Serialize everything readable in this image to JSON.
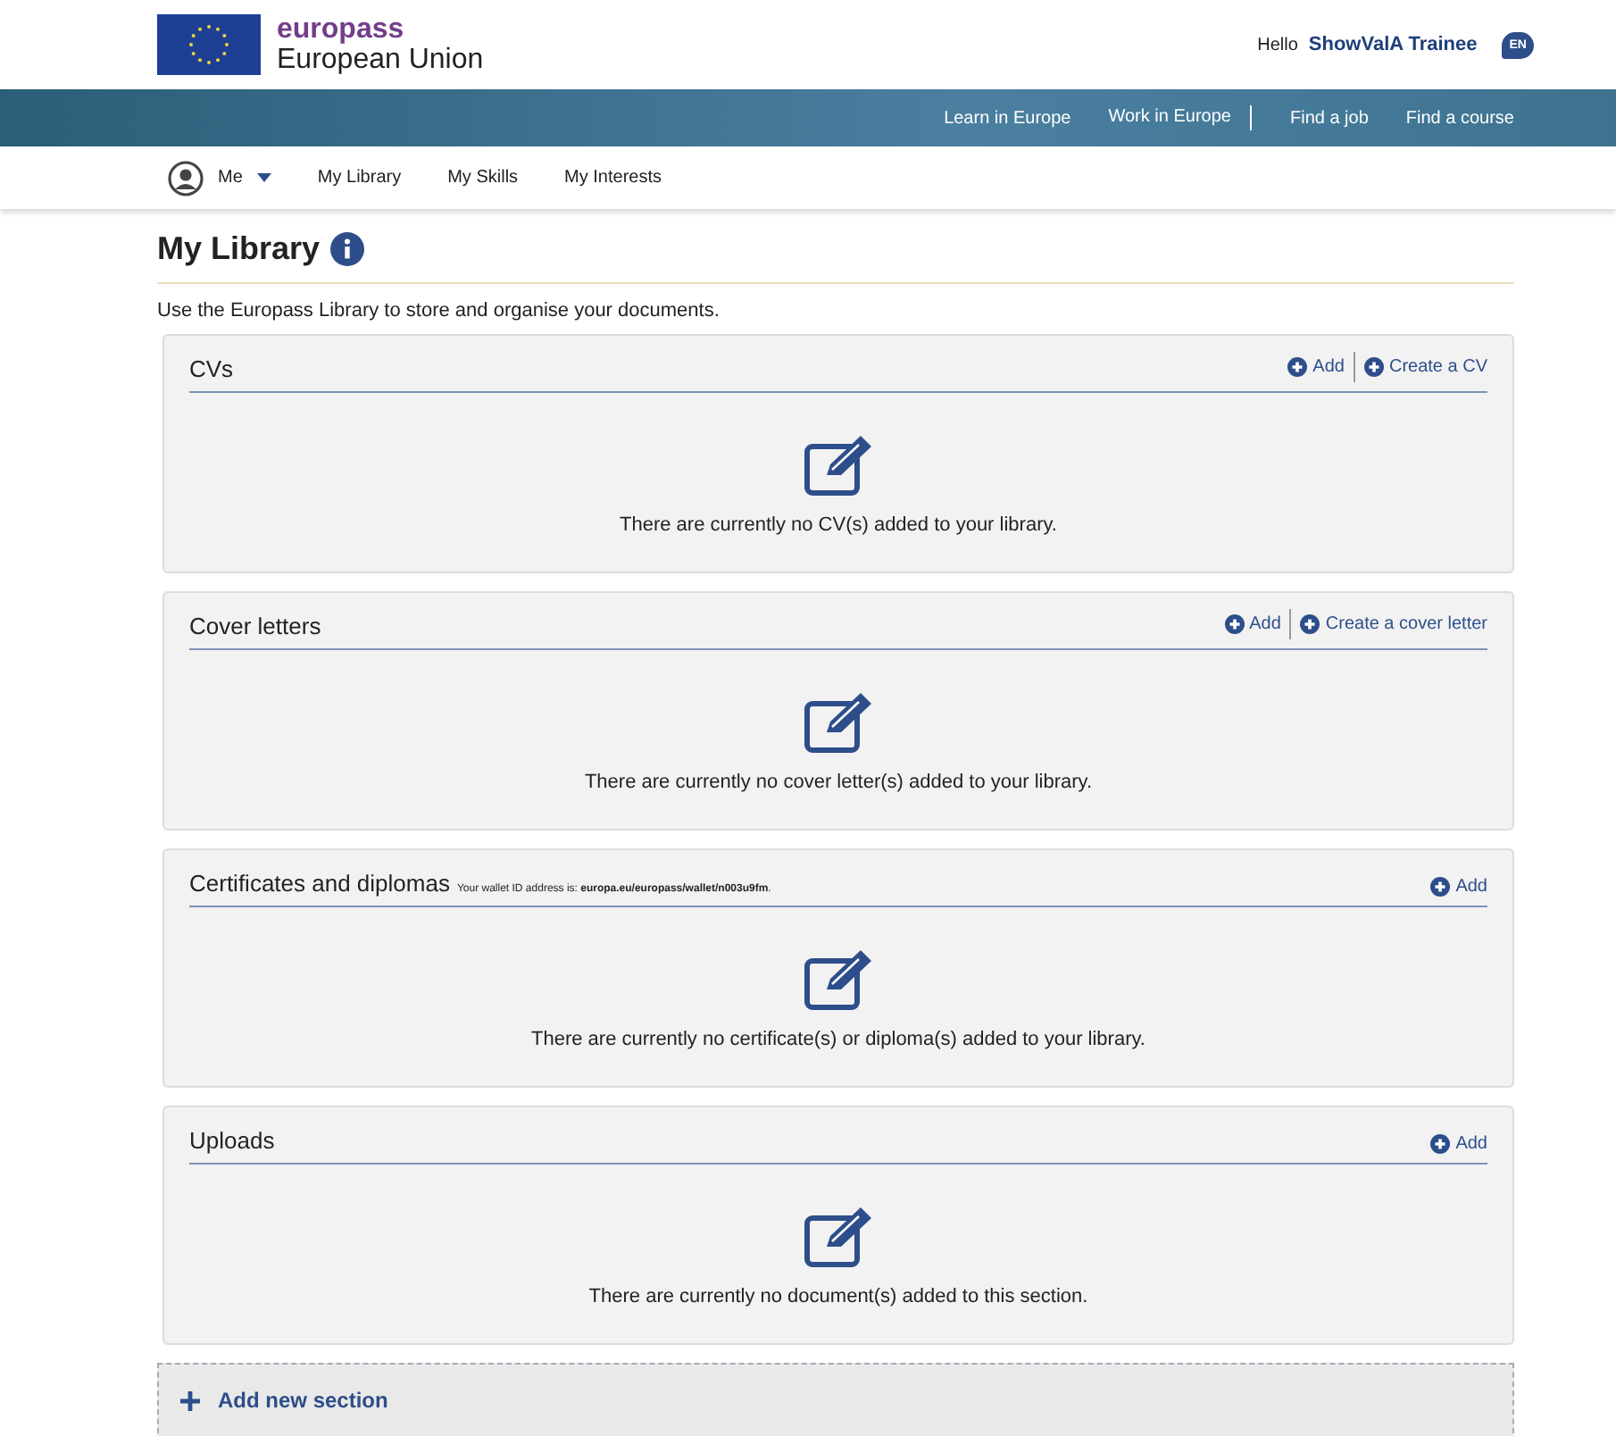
{
  "header": {
    "brand": "europass",
    "brand_sub": "European Union",
    "greeting": "Hello",
    "user": "ShowValA Trainee",
    "language": "EN"
  },
  "top_nav": [
    {
      "label": "Learn in Europe",
      "divider_after": false
    },
    {
      "label": "Work in Europe",
      "divider_after": true
    },
    {
      "label": "Find a job",
      "divider_after": false
    },
    {
      "label": "Find a course",
      "divider_after": false
    }
  ],
  "user_nav": {
    "me": "Me",
    "items": [
      {
        "label": "My Library"
      },
      {
        "label": "My Skills"
      },
      {
        "label": "My Interests"
      }
    ]
  },
  "page": {
    "title": "My Library",
    "intro": "Use the Europass Library to store and organise your documents."
  },
  "sections": [
    {
      "title": "CVs",
      "actions": [
        "Add",
        "Create a CV"
      ],
      "empty": "There are currently no CV(s) added to your library."
    },
    {
      "title": "Cover letters",
      "actions": [
        "Add",
        "Create a cover letter"
      ],
      "empty": "There are currently no cover letter(s) added to your library."
    },
    {
      "title": "Certificates and diplomas",
      "note": "Your wallet ID address is: **europa.eu/europass/wallet/n003u9fm**.",
      "actions": [
        "Add"
      ],
      "empty": "There are currently no certificate(s) or diploma(s) added to your library."
    },
    {
      "title": "Uploads",
      "actions": [
        "Add"
      ],
      "empty": "There are currently no document(s) added to this section."
    }
  ],
  "add_section": "Add new section"
}
